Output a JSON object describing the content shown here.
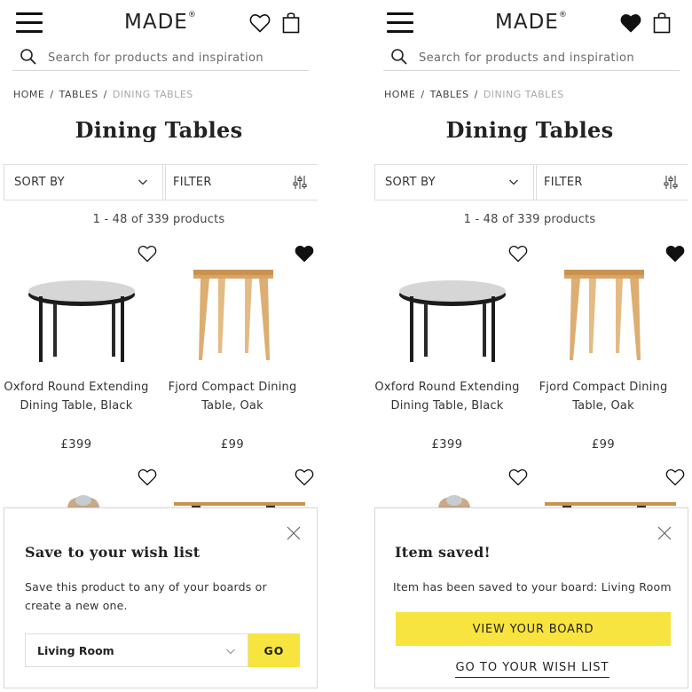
{
  "header": {
    "logo": "MADE",
    "logo_mark": "®"
  },
  "search": {
    "placeholder": "Search for products and inspiration"
  },
  "breadcrumb": {
    "home": "HOME",
    "tables": "TABLES",
    "current": "DINING TABLES",
    "separator": "/"
  },
  "page_title": "Dining Tables",
  "controls": {
    "sort_label": "SORT BY",
    "filter_label": "FILTER"
  },
  "results": {
    "count_text": "1 - 48  of  339 products"
  },
  "products": [
    {
      "name": "Oxford Round Extending Dining Table, Black",
      "price": "£399",
      "wishlisted": false
    },
    {
      "name": "Fjord Compact Dining Table, Oak",
      "price": "£99",
      "wishlisted": true
    }
  ],
  "wishlist_modal": {
    "title": "Save to your wish list",
    "body": "Save this product to any of your boards or create a new one.",
    "board_selected": "Living Room",
    "go_label": "GO"
  },
  "saved_modal": {
    "title": "Item saved!",
    "body": "Item has been saved to your board: Living Room",
    "view_board_label": "VIEW YOUR BOARD",
    "wishlist_link_label": "GO TO YOUR WISH LIST"
  },
  "colors": {
    "accent_yellow": "#f7e43f",
    "text": "#222222",
    "muted": "#a8a8a8",
    "border": "#dddddd"
  },
  "icons": [
    "menu-icon",
    "heart-icon",
    "heart-filled-icon",
    "bag-icon",
    "search-icon",
    "chevron-down-icon",
    "sliders-icon",
    "close-icon"
  ]
}
